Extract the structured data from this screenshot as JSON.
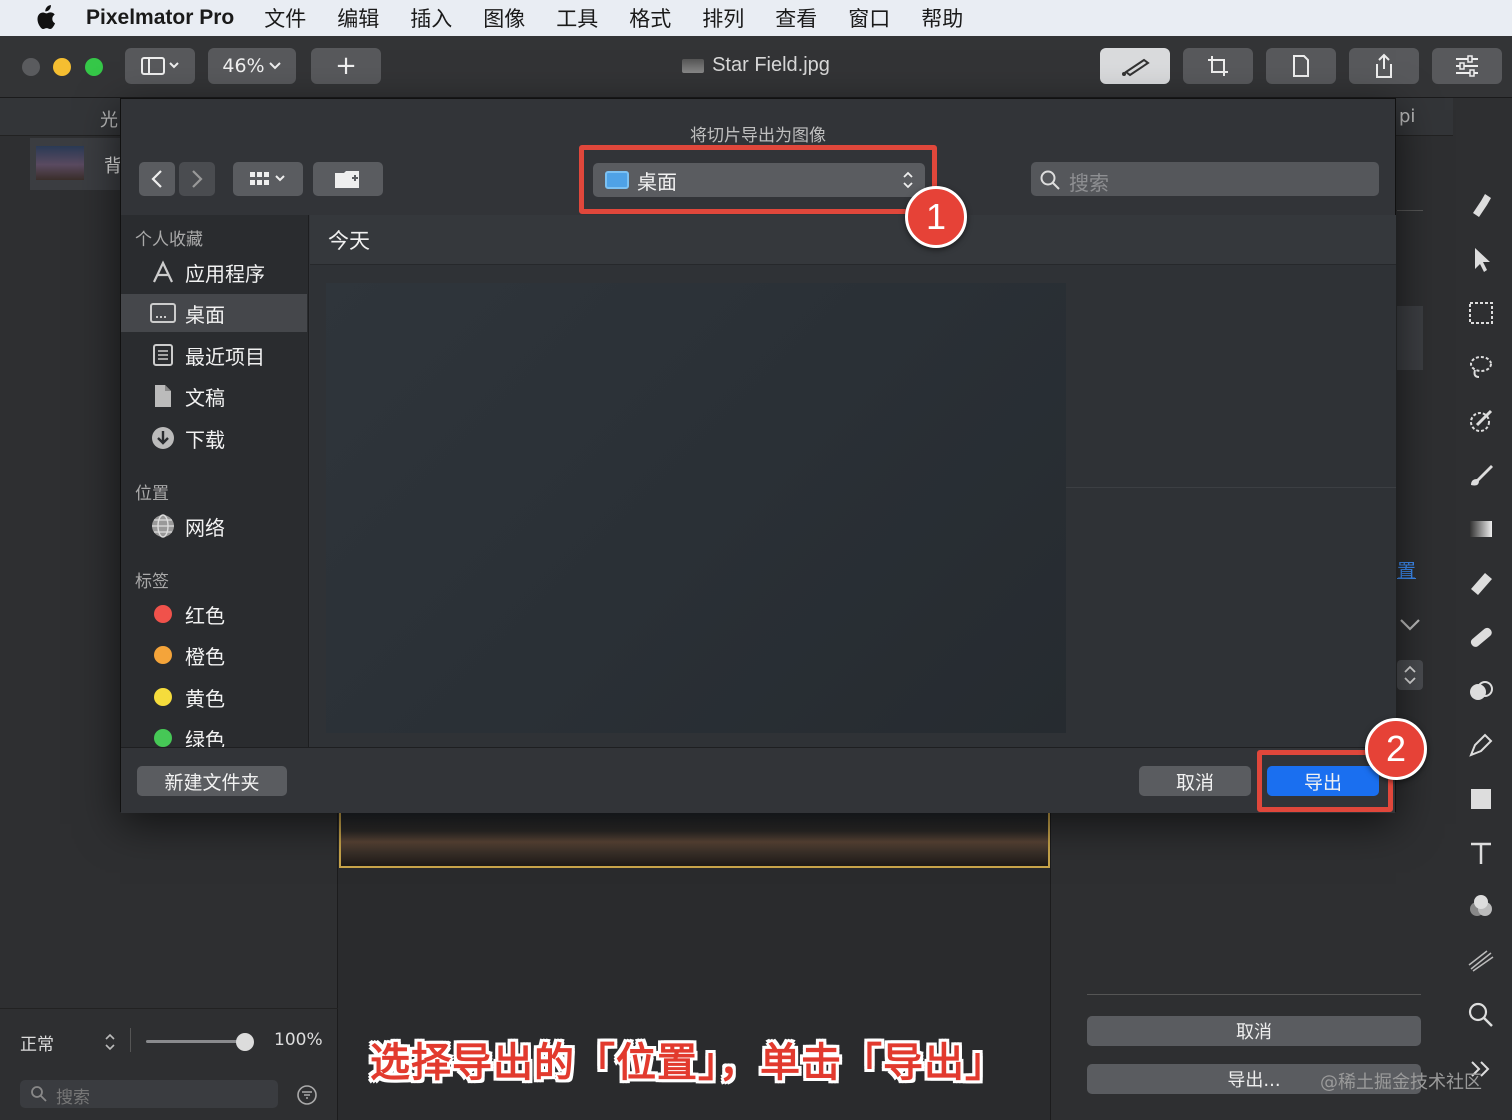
{
  "menubar": {
    "app_name": "Pixelmator Pro",
    "items": [
      "文件",
      "编辑",
      "插入",
      "图像",
      "工具",
      "格式",
      "排列",
      "查看",
      "窗口",
      "帮助"
    ]
  },
  "toolbar": {
    "zoom": "46%",
    "add_label": "+",
    "doc_title": "Star Field.jpg"
  },
  "left_panel": {
    "tab_fragment": "光",
    "layer_fragment": "背",
    "blend_mode": "正常",
    "opacity": "100%",
    "opacity_fraction": 1.0,
    "search_placeholder": "搜索"
  },
  "right_panel": {
    "fragment_top": "pi",
    "fragment_link": "置",
    "cancel_label": "取消",
    "export_label": "导出..."
  },
  "dialog": {
    "title": "将切片导出为图像",
    "location": "桌面",
    "search_placeholder": "搜索",
    "sidebar": {
      "favorites_header": "个人收藏",
      "favorites": [
        "应用程序",
        "桌面",
        "最近项目",
        "文稿",
        "下载"
      ],
      "locations_header": "位置",
      "locations": [
        "网络"
      ],
      "tags_header": "标签",
      "tags": [
        {
          "label": "红色",
          "color": "#f0524b"
        },
        {
          "label": "橙色",
          "color": "#f4a43a"
        },
        {
          "label": "黄色",
          "color": "#f5dc3c"
        },
        {
          "label": "绿色",
          "color": "#46c856"
        }
      ]
    },
    "group_header": "今天",
    "new_folder_label": "新建文件夹",
    "cancel_label": "取消",
    "export_label": "导出"
  },
  "annotations": {
    "badge1": "1",
    "badge2": "2",
    "caption": "选择导出的「位置」，单击「导出」",
    "watermark": "@稀土掘金技术社区"
  },
  "colors": {
    "accent_blue": "#1a6ff0",
    "annotation_red": "#e0473b"
  }
}
